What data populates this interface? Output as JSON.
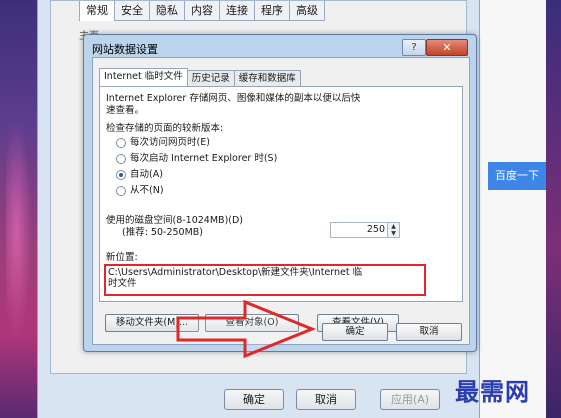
{
  "internet_options": {
    "tabs": [
      "常规",
      "安全",
      "隐私",
      "内容",
      "连接",
      "程序",
      "高级"
    ],
    "homepage_label": "主页",
    "buttons": {
      "ok": "确定",
      "cancel": "取消",
      "apply": "应用(A)"
    }
  },
  "browser": {
    "search_button": "百度一下"
  },
  "dialog": {
    "title": "网站数据设置",
    "help_icon": "question-icon",
    "close_icon": "close-icon",
    "tabs": [
      "Internet 临时文件",
      "历史记录",
      "缓存和数据库"
    ],
    "description_line1": "Internet Explorer 存储网页、图像和媒体的副本以便以后快",
    "description_line2": "速查看。",
    "check_label": "检查存储的页面的较新版本:",
    "radio_options": [
      "每次访问网页时(E)",
      "每次启动 Internet Explorer 时(S)",
      "自动(A)",
      "从不(N)"
    ],
    "selected_radio": 2,
    "disk_space_label": "使用的磁盘空间(8-1024MB)(D)",
    "disk_space_hint": "(推荐: 50-250MB)",
    "disk_space_value": "250",
    "new_location_label": "新位置:",
    "location_line1": "C:\\Users\\Administrator\\Desktop\\新建文件夹\\Internet 临",
    "location_line2": "时文件",
    "buttons": {
      "move_folder": "移动文件夹(M)...",
      "view_objects": "查看对象(O)",
      "view_files": "查看文件(V)",
      "ok": "确定",
      "cancel": "取消"
    },
    "highlight_color": "#e0282a"
  },
  "watermark": "最需网"
}
